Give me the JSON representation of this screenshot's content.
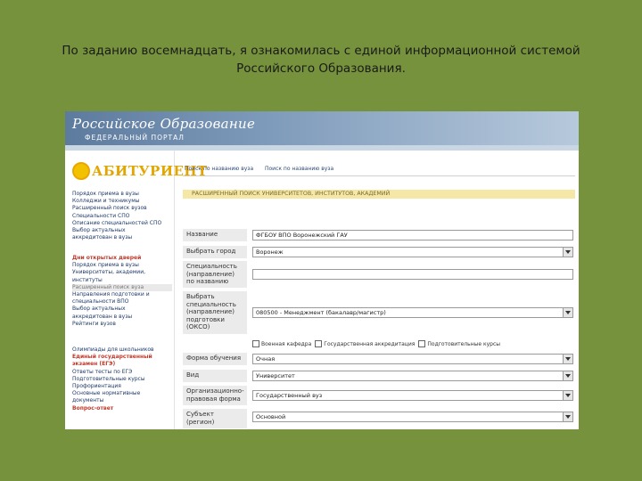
{
  "slide": {
    "title": "По заданию восемнадцать, я ознакомилась с единой информационной системой\nРоссийского Образования."
  },
  "portal": {
    "logo_text": "Российское Образование",
    "subtitle": "ФЕДЕРАЛЬНЫЙ ПОРТАЛ",
    "section_logo": "АБИТУРИЕНТ"
  },
  "sidebar": {
    "group1": [
      {
        "label": "Порядок приема в вузы"
      },
      {
        "label": "Колледжи и техникумы"
      },
      {
        "label": "Расширенный поиск вузов"
      },
      {
        "label": "Специальности СПО"
      },
      {
        "label": "Описание специальностей СПО"
      },
      {
        "label": "Выбор актуальных"
      },
      {
        "label": "аккредитован в вузы"
      }
    ],
    "group2_title": "Дни открытых дверей",
    "group2": [
      {
        "label": "Порядок приема в вузы"
      },
      {
        "label": "Университеты, академии,"
      },
      {
        "label": "институты"
      },
      {
        "label": "Расширенный поиск вуза",
        "highlight": true
      },
      {
        "label": "Направления подготовки и"
      },
      {
        "label": "специальности ВПО"
      },
      {
        "label": "Выбор актуальных"
      },
      {
        "label": "аккредитован в вузы"
      },
      {
        "label": "Рейтинги вузов"
      }
    ],
    "group3": [
      {
        "label": "Олимпиады для школьников"
      },
      {
        "label": "Единый государственный",
        "red": true
      },
      {
        "label": "экзамен (ЕГЭ)",
        "red": true
      },
      {
        "label": "Ответы тесты по ЕГЭ"
      },
      {
        "label": "Подготовительные курсы"
      },
      {
        "label": "Профориентация"
      },
      {
        "label": "Основные нормативные"
      },
      {
        "label": "документы"
      },
      {
        "label": "Вопрос-ответ",
        "red": true
      }
    ]
  },
  "tabs": [
    {
      "label": "Поиск по названию вуза"
    },
    {
      "label": "Поиск по названию вуза"
    }
  ],
  "section_header": "РАСШИРЕННЫЙ ПОИСК УНИВЕРСИТЕТОВ, ИНСТИТУТОВ, АКАДЕМИЙ",
  "form": {
    "name": {
      "label": "Название",
      "value": "ФГБОУ ВПО Воронежский ГАУ"
    },
    "city": {
      "label": "Выбрать город",
      "value": "Воронеж"
    },
    "spec_by_name": {
      "label": "Специальность (направление) по названию",
      "value": ""
    },
    "spec_by_code": {
      "label": "Выбрать специальность (направление) подготовки (ОКСО)",
      "value": "080500 - Менеджмент (бакалавр/магистр)"
    },
    "checkboxes": [
      {
        "label": "Военная кафедра"
      },
      {
        "label": "Государственная аккредитация"
      },
      {
        "label": "Подготовительные курсы"
      }
    ],
    "study_form": {
      "label": "Форма обучения",
      "value": "Очная"
    },
    "type": {
      "label": "Вид",
      "value": "Университет"
    },
    "ownership": {
      "label": "Организационно-правовая форма",
      "value": "Государственный вуз"
    },
    "district": {
      "label": "Субъект (регион)",
      "value": "Основной"
    }
  }
}
